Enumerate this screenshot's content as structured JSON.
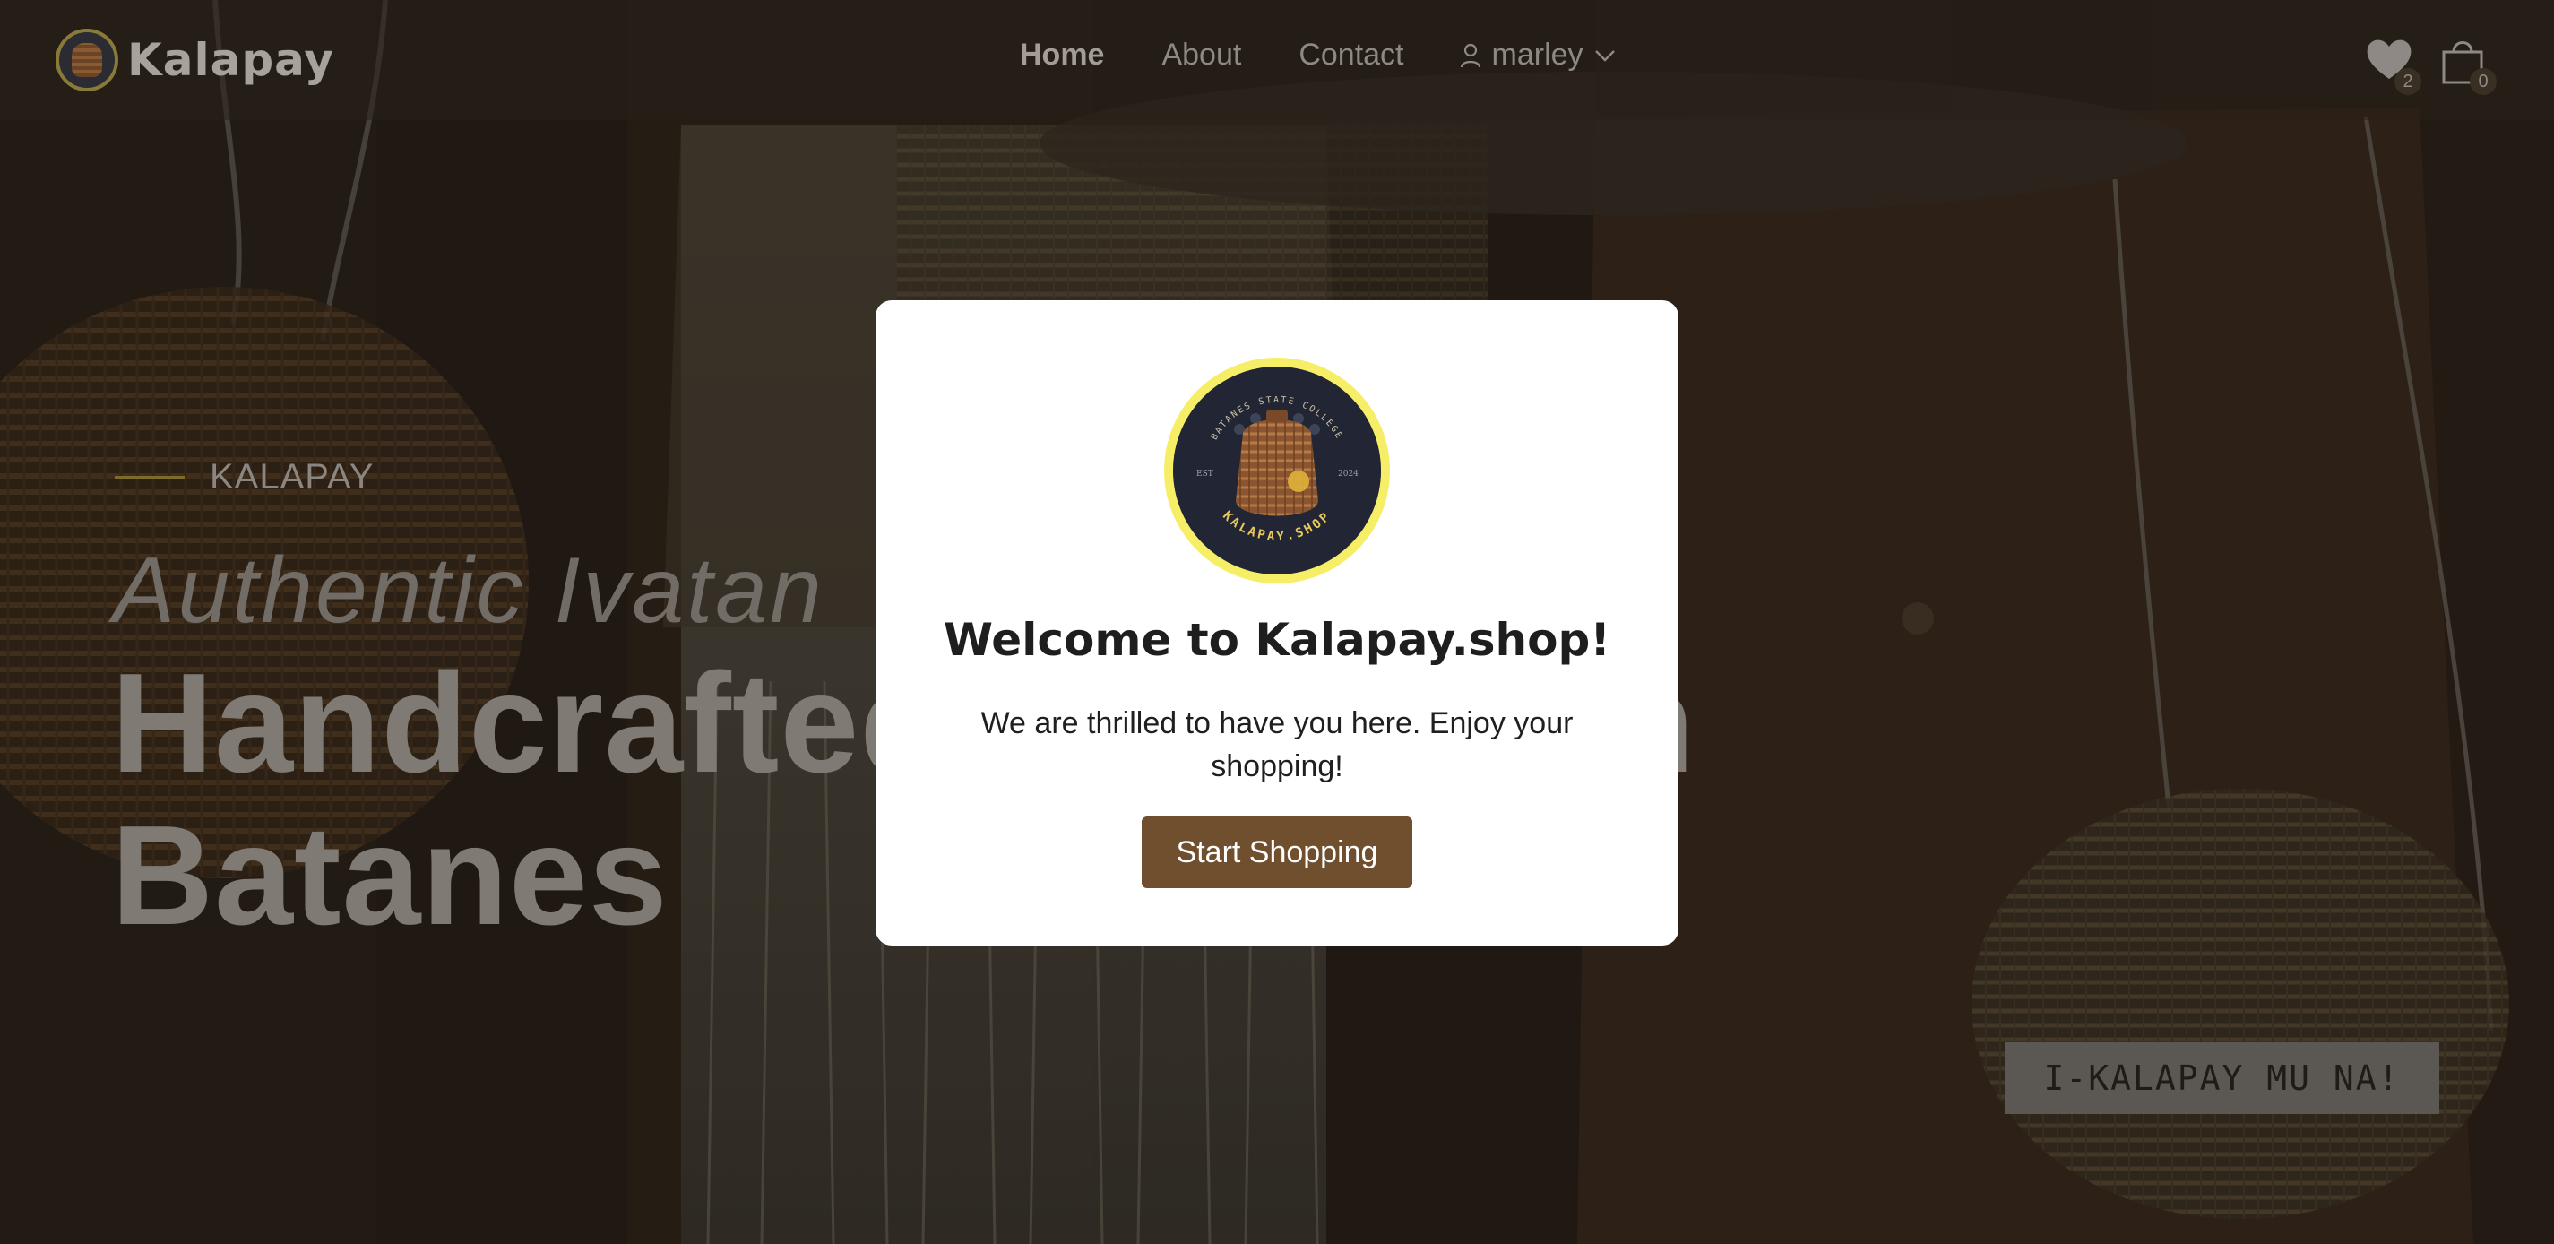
{
  "navbar": {
    "brand_name": "Kalapay",
    "links": [
      {
        "label": "Home",
        "active": true
      },
      {
        "label": "About",
        "active": false
      },
      {
        "label": "Contact",
        "active": false
      }
    ],
    "user_name": "marley",
    "wishlist_count": "2",
    "cart_count": "0"
  },
  "hero": {
    "eyebrow": "KALAPAY",
    "subtitle": "Authentic Ivatan",
    "title_line1": "Handcrafted Bags from",
    "title_line2": "Batanes",
    "cta_label": "I-KALAPAY MU NA!"
  },
  "modal": {
    "logo_top_text": "BATANES STATE COLLEGE",
    "logo_left_text": "EST",
    "logo_right_text": "2024",
    "logo_bottom_text": "KALAPAY.SHOP",
    "title": "Welcome to Kalapay.shop!",
    "message": "We are thrilled to have you here. Enjoy your shopping!",
    "button_label": "Start Shopping"
  },
  "colors": {
    "modal_button": "#6f4f2e",
    "logo_ring": "#f6ee67",
    "eyebrow_line": "#7c6c2a"
  }
}
